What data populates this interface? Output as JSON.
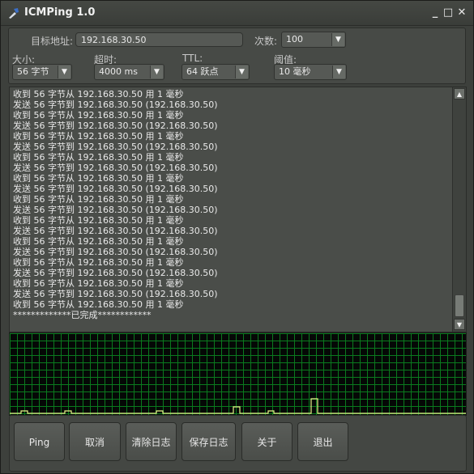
{
  "window": {
    "title": "ICMPing 1.0",
    "min_glyph": "_",
    "max_glyph": "□",
    "close_glyph": "✕"
  },
  "settings": {
    "target_label": "目标地址:",
    "target_value": "192.168.30.50",
    "count_label": "次数:",
    "count_value": "100",
    "size_label": "大小:",
    "size_value": "56 字节",
    "timeout_label": "超时:",
    "timeout_value": "4000 ms",
    "ttl_label": "TTL:",
    "ttl_value": "64 跃点",
    "threshold_label": "阈值:",
    "threshold_value": "10 毫秒"
  },
  "log": {
    "lines": [
      "收到 56 字节从 192.168.30.50 用 1 毫秒",
      "发送 56 字节到 192.168.30.50 (192.168.30.50)",
      "收到 56 字节从 192.168.30.50 用 1 毫秒",
      "发送 56 字节到 192.168.30.50 (192.168.30.50)",
      "收到 56 字节从 192.168.30.50 用 1 毫秒",
      "发送 56 字节到 192.168.30.50 (192.168.30.50)",
      "收到 56 字节从 192.168.30.50 用 1 毫秒",
      "发送 56 字节到 192.168.30.50 (192.168.30.50)",
      "收到 56 字节从 192.168.30.50 用 1 毫秒",
      "发送 56 字节到 192.168.30.50 (192.168.30.50)",
      "收到 56 字节从 192.168.30.50 用 1 毫秒",
      "发送 56 字节到 192.168.30.50 (192.168.30.50)",
      "收到 56 字节从 192.168.30.50 用 1 毫秒",
      "发送 56 字节到 192.168.30.50 (192.168.30.50)",
      "收到 56 字节从 192.168.30.50 用 1 毫秒",
      "发送 56 字节到 192.168.30.50 (192.168.30.50)",
      "收到 56 字节从 192.168.30.50 用 1 毫秒",
      "发送 56 字节到 192.168.30.50 (192.168.30.50)",
      "收到 56 字节从 192.168.30.50 用 1 毫秒",
      "发送 56 字节到 192.168.30.50 (192.168.30.50)",
      "收到 56 字节从 192.168.30.50 用 1 毫秒",
      "*************已完成************"
    ],
    "scroll_up": "▲",
    "scroll_down": "▼"
  },
  "buttons": {
    "ping": "Ping",
    "cancel": "取消",
    "clear_log": "清除日志",
    "save_log": "保存日志",
    "about": "关于",
    "exit": "退出"
  },
  "colors": {
    "graph_grid": "#0a7a1e",
    "graph_trace": "#e8f58a",
    "graph_bg": "#050806"
  }
}
